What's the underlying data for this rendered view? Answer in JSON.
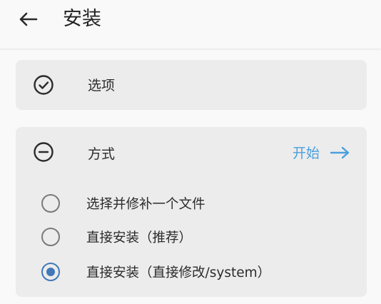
{
  "appbar": {
    "back_icon": "arrow-left-icon",
    "title": "安装"
  },
  "options_card": {
    "icon": "check-circle-icon",
    "label": "选项"
  },
  "method_card": {
    "icon": "minus-circle-icon",
    "label": "方式",
    "start_label": "开始",
    "start_icon": "arrow-right-icon",
    "accent_color": "#4a9fdc",
    "radio_options": [
      {
        "label": "选择并修补一个文件",
        "selected": false
      },
      {
        "label": "直接安装（推荐）",
        "selected": false
      },
      {
        "label": "直接安装（直接修改/system）",
        "selected": true
      }
    ],
    "selected_color": "#4178b8"
  }
}
